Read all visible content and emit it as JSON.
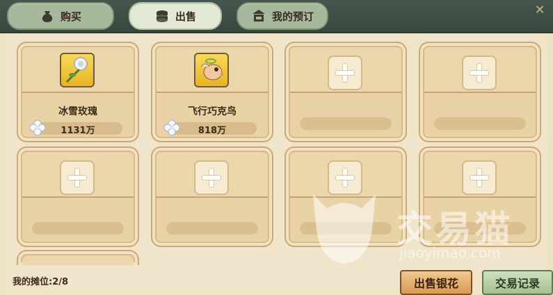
{
  "tabs": [
    {
      "label": "购买",
      "icon": "money-bag-icon"
    },
    {
      "label": "出售",
      "icon": "coin-stack-icon"
    },
    {
      "label": "我的预订",
      "icon": "shop-icon"
    }
  ],
  "active_tab": "出售",
  "slots": [
    {
      "name": "冰雪玫瑰",
      "price": "1131万",
      "icon": "white-rose-icon"
    },
    {
      "name": "飞行巧克鸟",
      "price": "818万",
      "icon": "flying-bird-icon"
    }
  ],
  "currency_icon": "silver-flower-icon",
  "stall_count_label": "我的摊位:2/8",
  "buttons": {
    "sell_silver": "出售银花",
    "trade_record": "交易记录"
  },
  "watermark": {
    "text": "交易猫",
    "url": "jiaoyimao.com"
  },
  "colors": {
    "topbar": "#3f5047",
    "tab_active": "#e2ead6",
    "slot": "#e9d2a6",
    "sell_button": "#e3b06f",
    "record_button": "#b9d1a7"
  }
}
